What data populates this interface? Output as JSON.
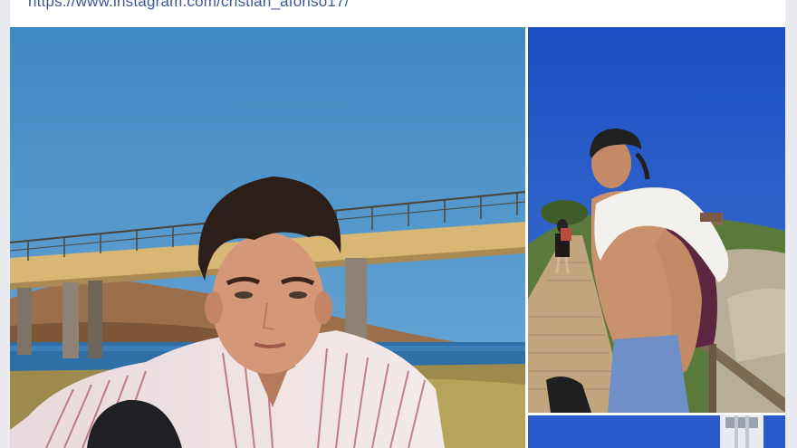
{
  "post": {
    "link_text": "https://www.instagram.com/cristian_afonso17/"
  },
  "photos": [
    {
      "name": "photo-bridge",
      "scene": "young man in striped shirt posing in front of a concrete bridge over a reservoir"
    },
    {
      "name": "photo-boardwalk",
      "scene": "shirtless young man with cap and backpack on a wooden boardwalk"
    },
    {
      "name": "photo-lighthouse",
      "scene": "partially visible photo with blue sky and a white tower"
    }
  ],
  "colors": {
    "page_background": "#e9ebee",
    "card_background": "#ffffff",
    "link": "#385898",
    "sky": "#3f89c3",
    "sky_deep": "#1d4fc4"
  }
}
